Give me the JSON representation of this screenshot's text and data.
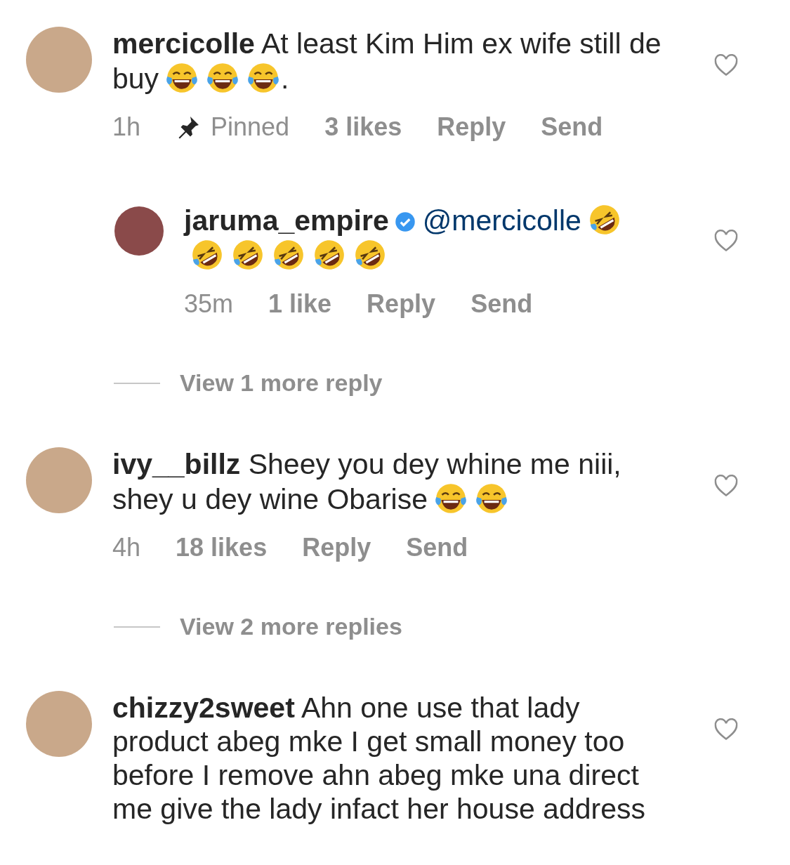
{
  "comments": [
    {
      "username": "mercicolle",
      "verified": false,
      "liked": false,
      "parts": [
        {
          "kind": "text",
          "text": "At least Kim Him ex wife still de buy"
        },
        {
          "kind": "laugh"
        },
        {
          "kind": "laugh"
        },
        {
          "kind": "laugh"
        },
        {
          "kind": "text",
          "text": "."
        }
      ],
      "meta": [
        {
          "kind": "time",
          "text": "1h"
        },
        {
          "kind": "pinned",
          "text": "Pinned"
        },
        {
          "kind": "likes",
          "text": "3 likes"
        },
        {
          "kind": "action",
          "text": "Reply"
        },
        {
          "kind": "action",
          "text": "Send"
        }
      ],
      "replies": [
        {
          "username": "jaruma_empire",
          "verified": true,
          "liked": false,
          "parts": [
            {
              "kind": "mention",
              "text": "@mercicolle"
            },
            {
              "kind": "rofl"
            },
            {
              "kind": "rofl"
            },
            {
              "kind": "rofl"
            },
            {
              "kind": "rofl"
            },
            {
              "kind": "rofl"
            },
            {
              "kind": "rofl"
            }
          ],
          "meta": [
            {
              "kind": "time",
              "text": "35m"
            },
            {
              "kind": "likes",
              "text": "1 like"
            },
            {
              "kind": "action",
              "text": "Reply"
            },
            {
              "kind": "action",
              "text": "Send"
            }
          ]
        }
      ],
      "view_replies": "View 1 more reply"
    },
    {
      "username": "ivy__billz",
      "verified": false,
      "liked": false,
      "parts": [
        {
          "kind": "text",
          "text": "Sheey you dey whine me niii, shey u dey wine Obarise"
        },
        {
          "kind": "laugh"
        },
        {
          "kind": "laugh"
        }
      ],
      "meta": [
        {
          "kind": "time",
          "text": "4h"
        },
        {
          "kind": "likes",
          "text": "18 likes"
        },
        {
          "kind": "action",
          "text": "Reply"
        },
        {
          "kind": "action",
          "text": "Send"
        }
      ],
      "view_replies": "View 2 more replies"
    },
    {
      "username": "chizzy2sweet",
      "verified": false,
      "liked": false,
      "parts": [
        {
          "kind": "text",
          "text": "Ahn one use that lady product abeg mke I get small money too before I remove ahn abeg mke una direct me give the lady infact her house address"
        }
      ]
    }
  ]
}
